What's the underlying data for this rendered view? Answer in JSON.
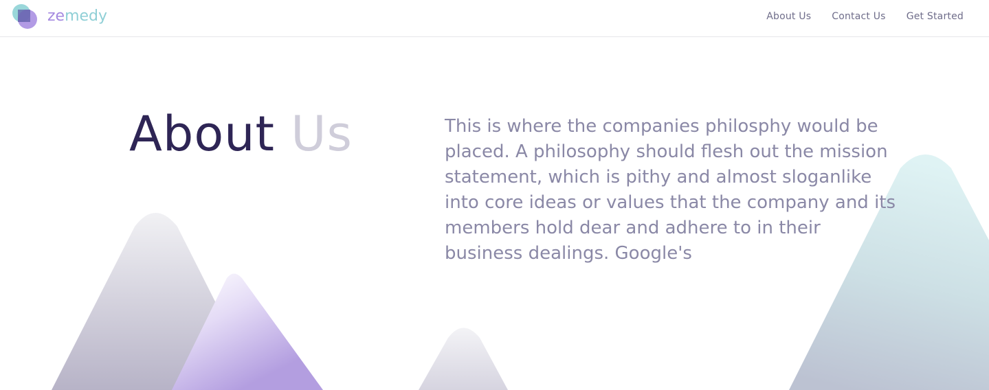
{
  "brand": {
    "name_part1": "ze",
    "name_part2": "medy",
    "colors": {
      "purple": "#a58ae0",
      "teal": "#8fcfd6",
      "navy": "#2e2555"
    }
  },
  "nav": {
    "items": [
      {
        "label": "About Us"
      },
      {
        "label": "Contact Us"
      },
      {
        "label": "Get Started"
      }
    ]
  },
  "hero": {
    "title_primary": "About",
    "title_secondary": "Us",
    "body": "This is where the companies philosphy would be placed. A philosophy should flesh out the mission statement, which is pithy and almost sloganlike into core ideas or values that the company and its members hold dear and adhere to in their business dealings. Google's"
  }
}
